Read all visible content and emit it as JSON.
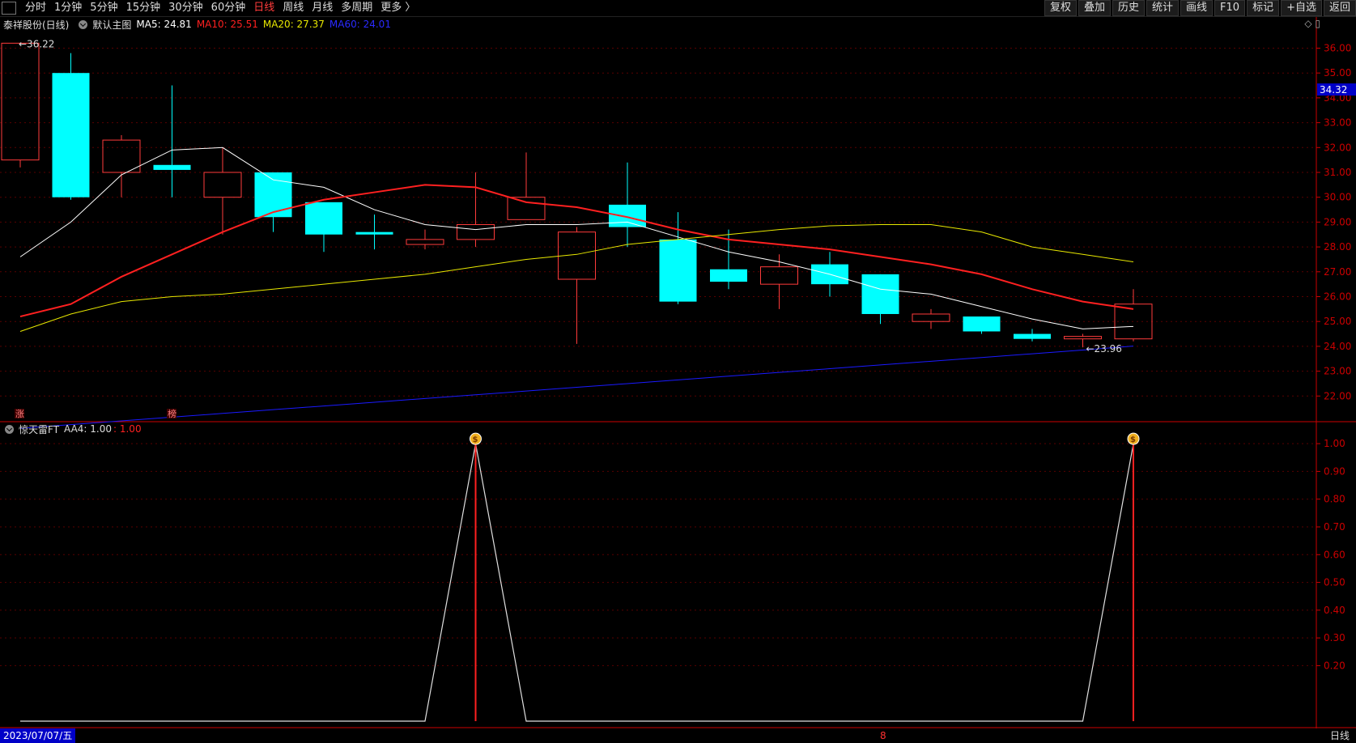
{
  "toolbar": {
    "tabs": [
      "分时",
      "1分钟",
      "5分钟",
      "15分钟",
      "30分钟",
      "60分钟",
      "日线",
      "周线",
      "月线",
      "多周期",
      "更多 〉"
    ],
    "active_tab": "日线",
    "buttons": [
      "复权",
      "叠加",
      "历史",
      "统计",
      "画线",
      "F10",
      "标记",
      "+自选",
      "返回"
    ]
  },
  "main_legend": {
    "title": "泰祥股份(日线)",
    "template": "默认主图",
    "ma5_label": "MA5: 24.81",
    "ma10_label": "MA10: 25.51",
    "ma20_label": "MA20: 27.37",
    "ma60_label": "MA60: 24.01"
  },
  "indicator_legend": {
    "name": "惊天雷FT",
    "aa4_label": "AA4: 1.00",
    "value_label": ": 1.00"
  },
  "markers": {
    "high_label": "36.22",
    "low_label": "23.96",
    "last_price": "34.32",
    "zhang_glyph": "涨",
    "bang_glyph": "榜"
  },
  "bottom": {
    "date": "2023/07/07/五",
    "mid_marker": "8",
    "period": "日线"
  },
  "colors": {
    "up": "#ff3b3b",
    "down": "#00ffff",
    "ma5": "#ffffff",
    "ma10": "#ff2020",
    "ma20": "#e8e800",
    "ma60": "#1a1aff",
    "axis": "#cc0000"
  },
  "chart_data": [
    {
      "type": "candlestick",
      "title": "泰祥股份(日线)",
      "ylim": [
        21.0,
        36.7
      ],
      "y_ticks": [
        "22.00",
        "23.00",
        "24.00",
        "25.00",
        "26.00",
        "27.00",
        "28.00",
        "29.00",
        "30.00",
        "31.00",
        "32.00",
        "33.00",
        "34.00",
        "35.00",
        "36.00"
      ],
      "candles": [
        {
          "o": 31.5,
          "h": 36.22,
          "l": 31.2,
          "c": 36.2
        },
        {
          "o": 35.0,
          "h": 35.8,
          "l": 29.9,
          "c": 30.0
        },
        {
          "o": 31.0,
          "h": 32.5,
          "l": 30.0,
          "c": 32.3
        },
        {
          "o": 31.3,
          "h": 34.5,
          "l": 30.0,
          "c": 31.1
        },
        {
          "o": 30.0,
          "h": 32.0,
          "l": 28.5,
          "c": 31.0
        },
        {
          "o": 31.0,
          "h": 31.0,
          "l": 28.6,
          "c": 29.2
        },
        {
          "o": 29.8,
          "h": 29.8,
          "l": 27.8,
          "c": 28.5
        },
        {
          "o": 28.6,
          "h": 29.3,
          "l": 27.9,
          "c": 28.5
        },
        {
          "o": 28.1,
          "h": 28.7,
          "l": 27.9,
          "c": 28.3
        },
        {
          "o": 28.3,
          "h": 31.0,
          "l": 28.0,
          "c": 28.9
        },
        {
          "o": 29.1,
          "h": 31.8,
          "l": 29.1,
          "c": 30.0
        },
        {
          "o": 26.7,
          "h": 28.8,
          "l": 24.1,
          "c": 28.6
        },
        {
          "o": 29.7,
          "h": 31.4,
          "l": 28.0,
          "c": 28.8
        },
        {
          "o": 28.3,
          "h": 29.4,
          "l": 25.7,
          "c": 25.8
        },
        {
          "o": 27.1,
          "h": 28.7,
          "l": 26.3,
          "c": 26.6
        },
        {
          "o": 26.5,
          "h": 27.7,
          "l": 25.5,
          "c": 27.2
        },
        {
          "o": 27.3,
          "h": 27.8,
          "l": 26.0,
          "c": 26.5
        },
        {
          "o": 26.9,
          "h": 26.9,
          "l": 24.9,
          "c": 25.3
        },
        {
          "o": 25.0,
          "h": 25.5,
          "l": 24.7,
          "c": 25.3
        },
        {
          "o": 25.2,
          "h": 25.2,
          "l": 24.5,
          "c": 24.6
        },
        {
          "o": 24.5,
          "h": 24.7,
          "l": 24.2,
          "c": 24.3
        },
        {
          "o": 24.3,
          "h": 24.5,
          "l": 23.96,
          "c": 24.4
        },
        {
          "o": 24.3,
          "h": 26.3,
          "l": 24.2,
          "c": 25.7
        }
      ],
      "series": [
        {
          "name": "MA5",
          "values": [
            27.6,
            29.0,
            30.9,
            31.9,
            32.0,
            30.7,
            30.4,
            29.5,
            28.9,
            28.7,
            28.9,
            28.9,
            29.0,
            28.4,
            27.8,
            27.4,
            26.9,
            26.3,
            26.1,
            25.6,
            25.1,
            24.7,
            24.8
          ]
        },
        {
          "name": "MA10",
          "values": [
            25.2,
            25.7,
            26.8,
            27.7,
            28.6,
            29.4,
            29.9,
            30.2,
            30.5,
            30.4,
            29.8,
            29.6,
            29.2,
            28.7,
            28.3,
            28.1,
            27.9,
            27.6,
            27.3,
            26.9,
            26.3,
            25.8,
            25.5
          ]
        },
        {
          "name": "MA20",
          "values": [
            24.6,
            25.3,
            25.8,
            26.0,
            26.1,
            26.3,
            26.5,
            26.7,
            26.9,
            27.2,
            27.5,
            27.7,
            28.1,
            28.3,
            28.5,
            28.7,
            28.85,
            28.9,
            28.9,
            28.6,
            28.0,
            27.7,
            27.4
          ]
        },
        {
          "name": "MA60",
          "values": [
            20.7,
            20.85,
            21.0,
            21.15,
            21.3,
            21.45,
            21.6,
            21.75,
            21.9,
            22.05,
            22.2,
            22.35,
            22.5,
            22.65,
            22.8,
            22.95,
            23.1,
            23.25,
            23.4,
            23.55,
            23.7,
            23.85,
            24.01
          ]
        }
      ]
    },
    {
      "type": "line",
      "title": "惊天雷FT",
      "series_name": "AA4",
      "ylim": [
        0,
        1.05
      ],
      "y_ticks": [
        "0.20",
        "0.30",
        "0.40",
        "0.50",
        "0.60",
        "0.70",
        "0.80",
        "0.90",
        "1.00"
      ],
      "values": [
        0,
        0,
        0,
        0,
        0,
        0,
        0,
        0,
        0,
        1,
        0,
        0,
        0,
        0,
        0,
        0,
        0,
        0,
        0,
        0,
        0,
        0,
        1
      ],
      "signal_indices": [
        9,
        22
      ]
    }
  ]
}
